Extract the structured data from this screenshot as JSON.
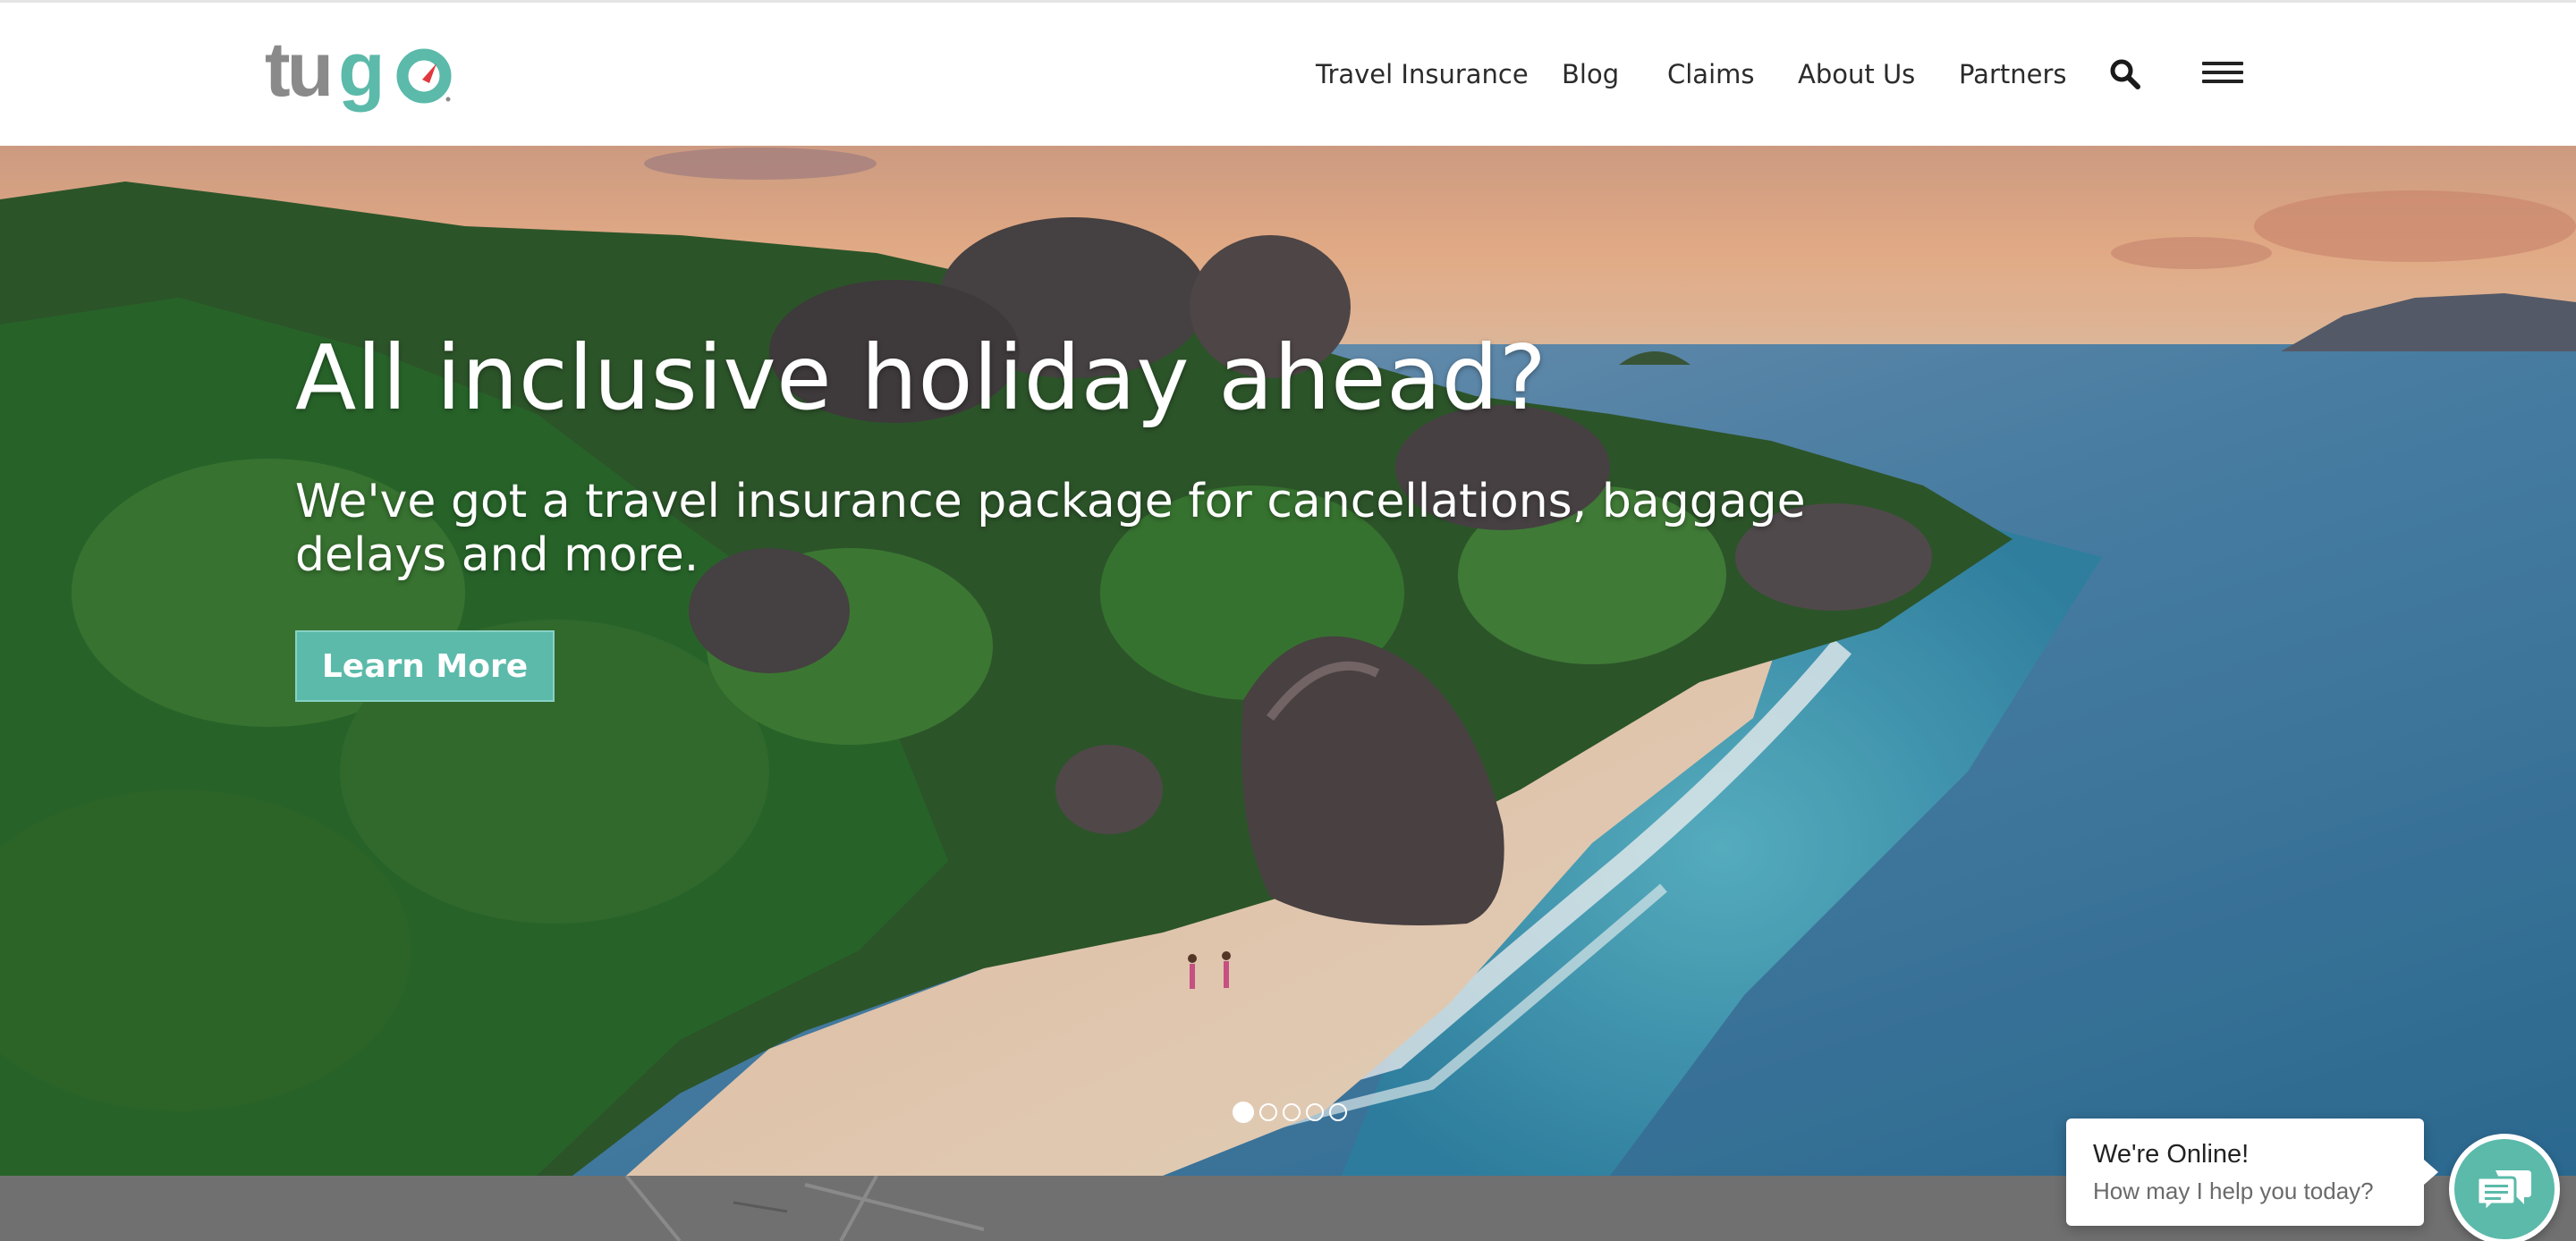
{
  "brand": {
    "logo_text": "tugo",
    "accent": "#5bbaaa",
    "logo_red": "#e03a3e"
  },
  "nav": {
    "items": [
      {
        "label": "Travel Insurance"
      },
      {
        "label": "Blog"
      },
      {
        "label": "Claims"
      },
      {
        "label": "About Us"
      },
      {
        "label": "Partners"
      }
    ],
    "search_icon": "search-icon",
    "menu_icon": "hamburger-menu-icon"
  },
  "hero": {
    "title": "All inclusive holiday ahead?",
    "subtitle": "We've got a travel insurance package for cancellations, baggage delays and more.",
    "cta_label": "Learn More",
    "slides_count": 5,
    "active_slide": 1
  },
  "chat": {
    "title": "We're Online!",
    "subtitle": "How may I help you today?",
    "launcher_icon": "chat-bubbles-icon"
  }
}
